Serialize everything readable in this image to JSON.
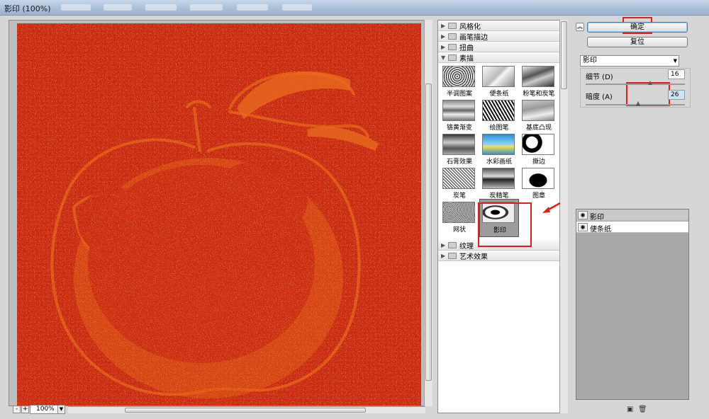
{
  "window": {
    "title": "影印 (100%)"
  },
  "preview": {
    "zoom": "100%",
    "zoom_out": "-",
    "zoom_in": "+"
  },
  "gallery": {
    "categories": [
      {
        "label": "风格化",
        "expanded": false
      },
      {
        "label": "画笔描边",
        "expanded": false
      },
      {
        "label": "扭曲",
        "expanded": false
      },
      {
        "label": "素描",
        "expanded": true
      },
      {
        "label": "纹理",
        "expanded": false
      },
      {
        "label": "艺术效果",
        "expanded": false
      }
    ],
    "sketch_filters": [
      "半调图案",
      "便条纸",
      "粉笔和炭笔",
      "铬黄渐变",
      "绘图笔",
      "基底凸现",
      "石膏效果",
      "水彩画纸",
      "撕边",
      "炭笔",
      "炭精笔",
      "图章",
      "网状",
      "影印"
    ],
    "selected_filter": "影印"
  },
  "controls": {
    "ok_label": "确定",
    "reset_label": "复位",
    "filter_select": "影印",
    "detail_label": "细节 (D)",
    "detail_value": "16",
    "darkness_label": "暗度 (A)",
    "darkness_value": "26",
    "collapse_icon": "double-chevron-up"
  },
  "layers": {
    "items": [
      {
        "name": "影印",
        "active": true
      },
      {
        "name": "便条纸",
        "active": false
      }
    ],
    "new_icon": "new-layer-icon",
    "delete_icon": "trash-icon"
  },
  "colors": {
    "canvas_red": "#c92a12",
    "canvas_orange": "#e05a16",
    "highlight_red": "#e0211b"
  }
}
